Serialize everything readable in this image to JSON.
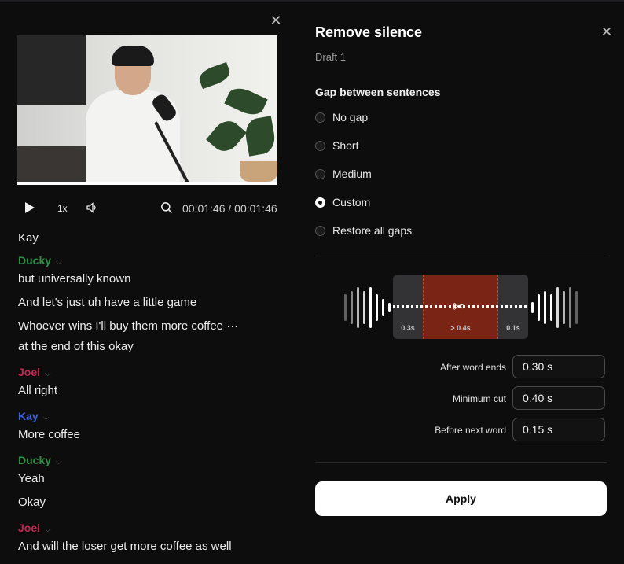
{
  "player": {
    "close_icon": "close-icon",
    "speed": "1x",
    "timecode": "00:01:46 / 00:01:46",
    "progress_fraction": 1.0
  },
  "transcript": [
    {
      "speaker": "",
      "color": "",
      "lines": [
        "Kay"
      ]
    },
    {
      "speaker": "Ducky",
      "color": "#2f8f46",
      "lines": [
        "but universally known",
        "And let's just uh have a little game",
        "Whoever wins I'll buy them more coffee ···",
        "at the end of this okay"
      ]
    },
    {
      "speaker": "Joel",
      "color": "#c0264e",
      "lines": [
        "All right"
      ]
    },
    {
      "speaker": "Kay",
      "color": "#3f63d8",
      "lines": [
        "More coffee"
      ]
    },
    {
      "speaker": "Ducky",
      "color": "#2f8f46",
      "lines": [
        "Yeah",
        "Okay"
      ]
    },
    {
      "speaker": "Joel",
      "color": "#c0264e",
      "lines": [
        "And will the loser get more coffee as well"
      ]
    }
  ],
  "panel": {
    "title": "Remove silence",
    "draft": "Draft 1",
    "gap_heading": "Gap between sentences",
    "options": [
      "No gap",
      "Short",
      "Medium",
      "Custom",
      "Restore all gaps"
    ],
    "selected_option": "Custom",
    "viz": {
      "before_label": "0.3s",
      "cut_label": "> 0.4s",
      "after_label": "0.1s",
      "cut_color": "#7a2415"
    },
    "fields": [
      {
        "label": "After word ends",
        "value": "0.30 s"
      },
      {
        "label": "Minimum cut",
        "value": "0.40 s"
      },
      {
        "label": "Before next word",
        "value": "0.15 s"
      }
    ],
    "apply_label": "Apply"
  }
}
